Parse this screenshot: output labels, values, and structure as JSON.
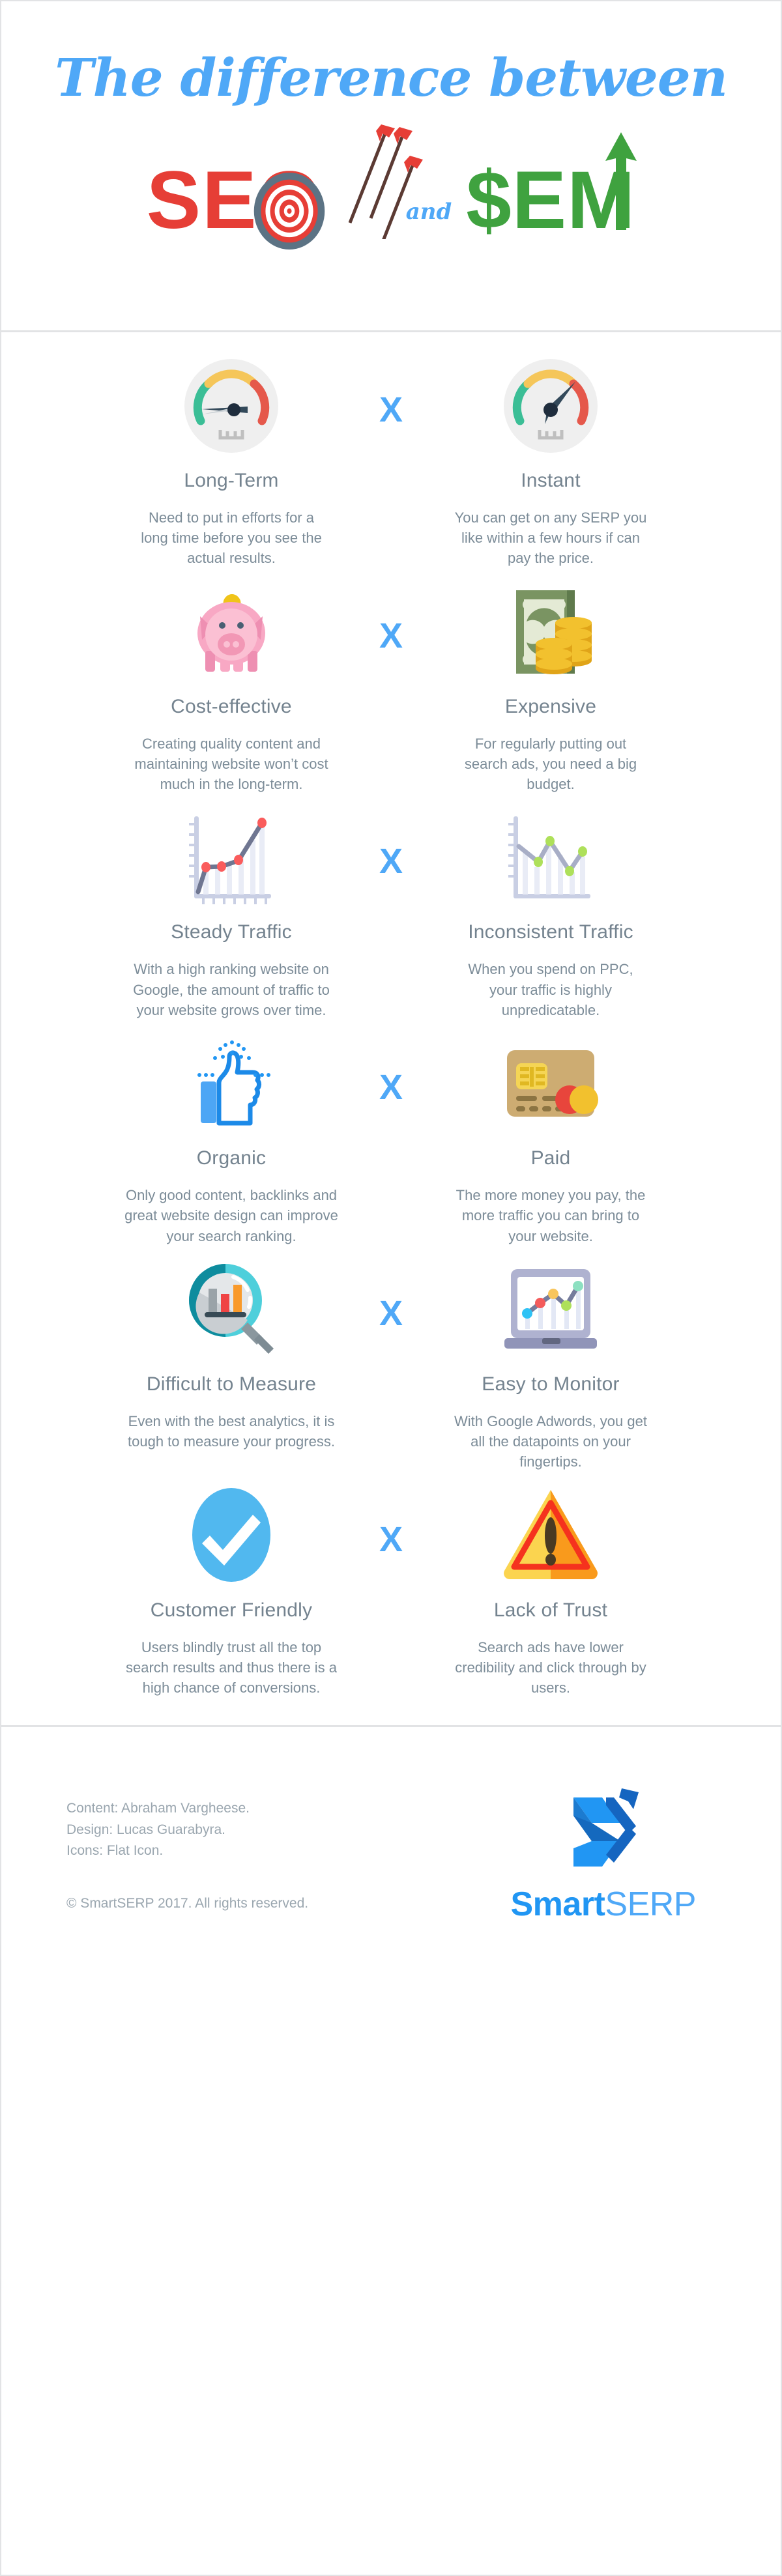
{
  "header": {
    "title_line1": "The difference between",
    "seo": "SEO",
    "and": "and",
    "sem": "$EM",
    "colors": {
      "title_blue": "#4FA8F7",
      "seo_red": "#E63E36",
      "sem_green": "#3FA23F"
    }
  },
  "separator_label": "X",
  "rows": [
    {
      "left": {
        "icon": "speedometer-slow-icon",
        "title": "Long-Term",
        "desc": "Need to put in efforts for a long time before you see the actual results."
      },
      "right": {
        "icon": "speedometer-fast-icon",
        "title": "Instant",
        "desc": "You can get on any SERP you like within a few hours if can pay the price."
      }
    },
    {
      "left": {
        "icon": "piggy-bank-icon",
        "title": "Cost-effective",
        "desc": "Creating quality content and maintaining  website won’t cost much in the long-term."
      },
      "right": {
        "icon": "money-coins-icon",
        "title": "Expensive",
        "desc": "For regularly putting out search ads, you need a big budget."
      }
    },
    {
      "left": {
        "icon": "rising-line-chart-icon",
        "title": "Steady Traffic",
        "desc": "With a high ranking website on Google, the amount of traffic to your website grows over time."
      },
      "right": {
        "icon": "volatile-line-chart-icon",
        "title": "Inconsistent Traffic",
        "desc": "When you spend on PPC, your traffic is highly unpredicatable."
      }
    },
    {
      "left": {
        "icon": "thumbs-up-icon",
        "title": "Organic",
        "desc": "Only good content, backlinks and great website design can improve your search ranking."
      },
      "right": {
        "icon": "credit-card-icon",
        "title": "Paid",
        "desc": "The more money you pay, the more traffic you can bring to your website."
      }
    },
    {
      "left": {
        "icon": "magnifier-bar-chart-icon",
        "title": "Difficult to Measure",
        "desc": "Even with the best analytics, it is tough to measure your progress."
      },
      "right": {
        "icon": "laptop-analytics-icon",
        "title": "Easy to Monitor",
        "desc": "With Google Adwords, you get all the datapoints on your fingertips."
      }
    },
    {
      "left": {
        "icon": "check-circle-icon",
        "title": "Customer Friendly",
        "desc": "Users blindly trust all the top search results and thus there is a high chance of conversions."
      },
      "right": {
        "icon": "warning-triangle-icon",
        "title": "Lack of Trust",
        "desc": "Search ads have lower credibility and click through by users."
      }
    }
  ],
  "footer": {
    "credit_content": "Content: Abraham Vargheese.",
    "credit_design": "Design: Lucas Guarabyra.",
    "credit_icons": "Icons: Flat Icon.",
    "copyright": "© SmartSERP 2017. All rights reserved.",
    "brand_first": "Smart",
    "brand_second": "SERP"
  }
}
